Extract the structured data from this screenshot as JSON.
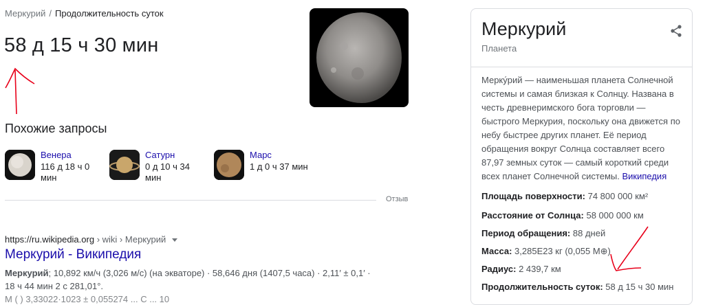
{
  "breadcrumb": {
    "parent": "Меркурий",
    "separator": "/",
    "current": "Продолжительность суток"
  },
  "answer": {
    "value": "58 д 15 ч 30 мин"
  },
  "related": {
    "title": "Похожие запросы",
    "items": [
      {
        "name": "Венера",
        "value": "116 д 18 ч 0 мин"
      },
      {
        "name": "Сатурн",
        "value": "0 д 10 ч 34 мин"
      },
      {
        "name": "Марс",
        "value": "1 д 0 ч 37 мин"
      }
    ]
  },
  "feedback": {
    "label": "Отзыв"
  },
  "result": {
    "url": "https://ru.wikipedia.org",
    "crumbs": "› wiki › Меркурий",
    "title": "Меркурий - Википедия",
    "snippet_bold": "Меркурий",
    "snippet_text": "; 10,892 км/ч (3,026 м/с) (на экваторе) · 58,646 дня (1407,5 часа) · 2,11′ ± 0,1′ · 18 ч 44 мин 2 с 281,01°.",
    "snippet_cut": "М           ( )  3,33022·1023  ±  0,055274  ...          С             ...                     10"
  },
  "knowledge_panel": {
    "title": "Меркурий",
    "subtitle": "Планета",
    "description": "Мерку́рий — наименьшая планета Солнечной системы и самая близкая к Солнцу. Названа в честь древнеримского бога торговли — быстрого Меркурия, поскольку она движется по небу быстрее других планет. Её период обращения вокруг Солнца составляет всего 87,97 земных суток — самый короткий среди всех планет Солнечной системы.",
    "source": "Википедия",
    "facts": [
      {
        "key": "Площадь поверхности:",
        "value": "74 800 000 км²"
      },
      {
        "key": "Расстояние от Солнца:",
        "value": "58 000 000 км"
      },
      {
        "key": "Период обращения:",
        "value": "88 дней"
      },
      {
        "key": "Масса:",
        "value": "3,285E23 кг (0,055 M⊕)"
      },
      {
        "key": "Радиус:",
        "value": "2 439,7 км"
      },
      {
        "key": "Продолжительность суток:",
        "value": "58 д 15 ч 30 мин"
      }
    ]
  },
  "icons": {
    "share": "share-icon",
    "dropdown": "caret-down-icon"
  },
  "colors": {
    "link": "#1a0dab",
    "annotation": "#e8001a",
    "text": "#202124",
    "muted": "#70757a"
  }
}
